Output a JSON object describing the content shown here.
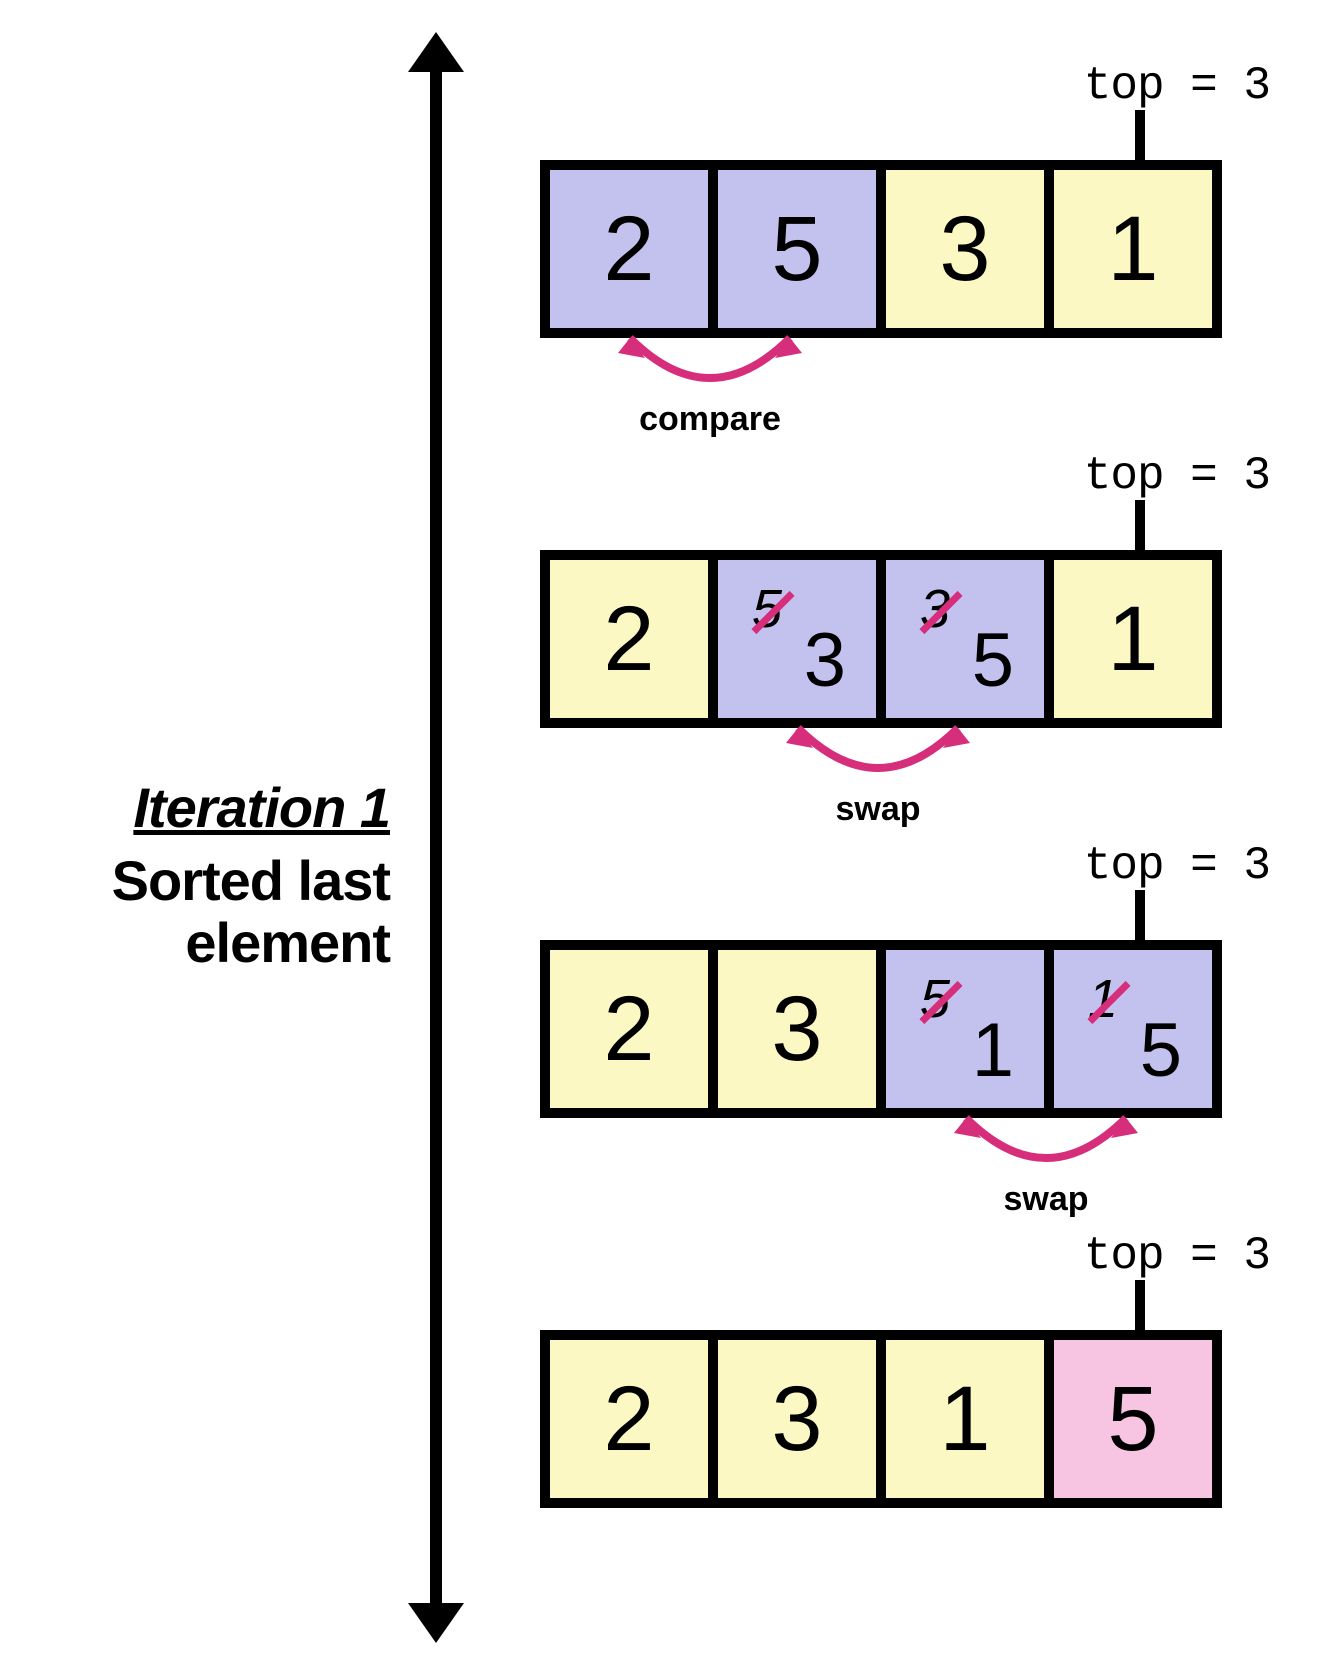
{
  "iteration_title": "Iteration 1",
  "iteration_subtitle": "Sorted last element",
  "top_label": "top = 3",
  "colors": {
    "yellow": "#fbf8c4",
    "purple": "#c3c2ef",
    "pink": "#f7c4e1",
    "magenta": "#d62e7b"
  },
  "steps": [
    {
      "cells": [
        {
          "value": "2",
          "color": "purple"
        },
        {
          "value": "5",
          "color": "purple"
        },
        {
          "value": "3",
          "color": "yellow"
        },
        {
          "value": "1",
          "color": "yellow"
        }
      ],
      "link": {
        "from": 0,
        "to": 1,
        "label": "compare"
      }
    },
    {
      "cells": [
        {
          "value": "2",
          "color": "yellow"
        },
        {
          "old": "5",
          "new": "3",
          "color": "purple",
          "swap": true
        },
        {
          "old": "3",
          "new": "5",
          "color": "purple",
          "swap": true
        },
        {
          "value": "1",
          "color": "yellow"
        }
      ],
      "link": {
        "from": 1,
        "to": 2,
        "label": "swap"
      }
    },
    {
      "cells": [
        {
          "value": "2",
          "color": "yellow"
        },
        {
          "value": "3",
          "color": "yellow"
        },
        {
          "old": "5",
          "new": "1",
          "color": "purple",
          "swap": true
        },
        {
          "old": "1",
          "new": "5",
          "color": "purple",
          "swap": true
        }
      ],
      "link": {
        "from": 2,
        "to": 3,
        "label": "swap"
      }
    },
    {
      "cells": [
        {
          "value": "2",
          "color": "yellow"
        },
        {
          "value": "3",
          "color": "yellow"
        },
        {
          "value": "1",
          "color": "yellow"
        },
        {
          "value": "5",
          "color": "pink"
        }
      ],
      "link": null
    }
  ]
}
